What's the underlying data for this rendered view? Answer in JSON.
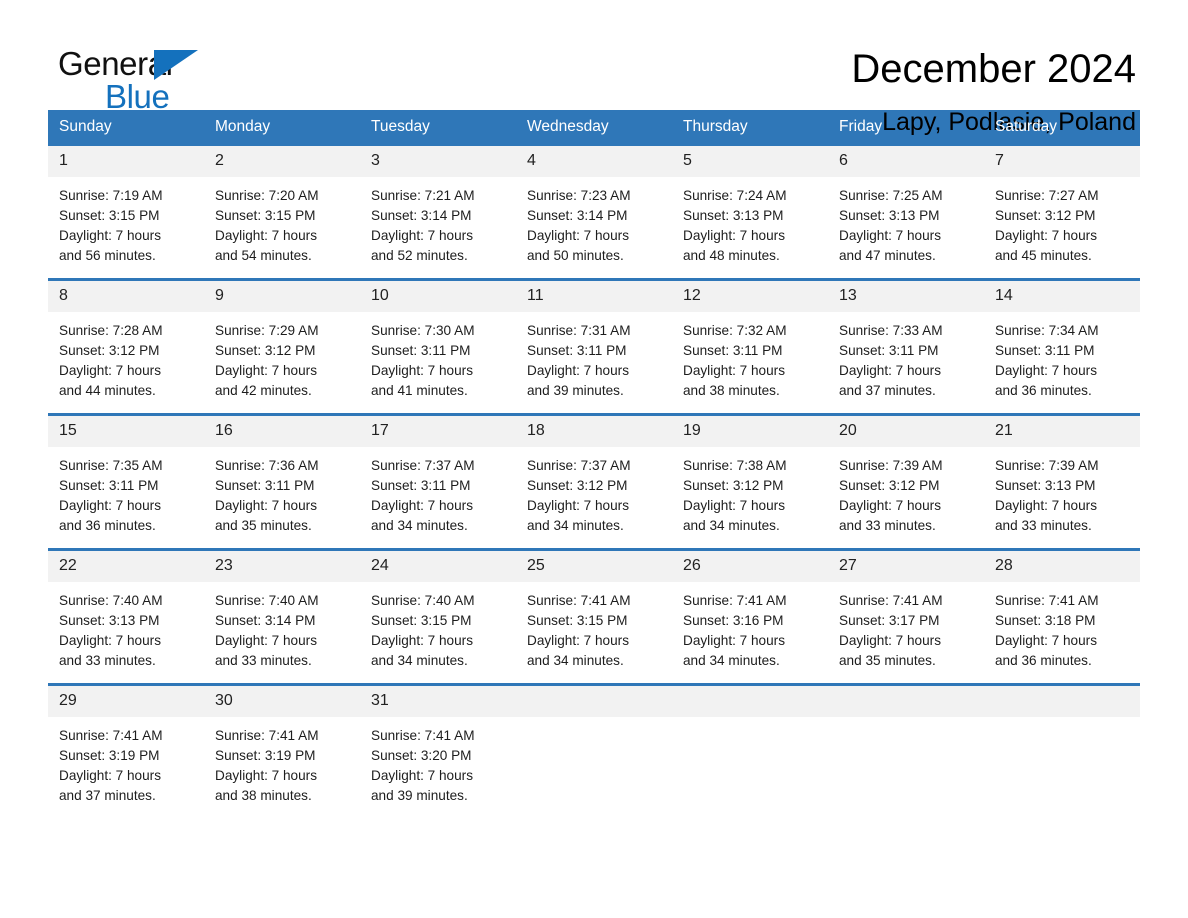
{
  "brand": {
    "name_part1": "General",
    "name_part2": "Blue",
    "accent_color": "#1471bd"
  },
  "header": {
    "title": "December 2024",
    "location": "Lapy, Podlasie, Poland"
  },
  "calendar": {
    "header_bg": "#2f77b8",
    "daynum_bg": "#f2f2f2",
    "weekday_headers": [
      "Sunday",
      "Monday",
      "Tuesday",
      "Wednesday",
      "Thursday",
      "Friday",
      "Saturday"
    ],
    "weeks": [
      [
        {
          "day": "1",
          "sunrise": "Sunrise: 7:19 AM",
          "sunset": "Sunset: 3:15 PM",
          "daylight_line1": "Daylight: 7 hours",
          "daylight_line2": "and 56 minutes."
        },
        {
          "day": "2",
          "sunrise": "Sunrise: 7:20 AM",
          "sunset": "Sunset: 3:15 PM",
          "daylight_line1": "Daylight: 7 hours",
          "daylight_line2": "and 54 minutes."
        },
        {
          "day": "3",
          "sunrise": "Sunrise: 7:21 AM",
          "sunset": "Sunset: 3:14 PM",
          "daylight_line1": "Daylight: 7 hours",
          "daylight_line2": "and 52 minutes."
        },
        {
          "day": "4",
          "sunrise": "Sunrise: 7:23 AM",
          "sunset": "Sunset: 3:14 PM",
          "daylight_line1": "Daylight: 7 hours",
          "daylight_line2": "and 50 minutes."
        },
        {
          "day": "5",
          "sunrise": "Sunrise: 7:24 AM",
          "sunset": "Sunset: 3:13 PM",
          "daylight_line1": "Daylight: 7 hours",
          "daylight_line2": "and 48 minutes."
        },
        {
          "day": "6",
          "sunrise": "Sunrise: 7:25 AM",
          "sunset": "Sunset: 3:13 PM",
          "daylight_line1": "Daylight: 7 hours",
          "daylight_line2": "and 47 minutes."
        },
        {
          "day": "7",
          "sunrise": "Sunrise: 7:27 AM",
          "sunset": "Sunset: 3:12 PM",
          "daylight_line1": "Daylight: 7 hours",
          "daylight_line2": "and 45 minutes."
        }
      ],
      [
        {
          "day": "8",
          "sunrise": "Sunrise: 7:28 AM",
          "sunset": "Sunset: 3:12 PM",
          "daylight_line1": "Daylight: 7 hours",
          "daylight_line2": "and 44 minutes."
        },
        {
          "day": "9",
          "sunrise": "Sunrise: 7:29 AM",
          "sunset": "Sunset: 3:12 PM",
          "daylight_line1": "Daylight: 7 hours",
          "daylight_line2": "and 42 minutes."
        },
        {
          "day": "10",
          "sunrise": "Sunrise: 7:30 AM",
          "sunset": "Sunset: 3:11 PM",
          "daylight_line1": "Daylight: 7 hours",
          "daylight_line2": "and 41 minutes."
        },
        {
          "day": "11",
          "sunrise": "Sunrise: 7:31 AM",
          "sunset": "Sunset: 3:11 PM",
          "daylight_line1": "Daylight: 7 hours",
          "daylight_line2": "and 39 minutes."
        },
        {
          "day": "12",
          "sunrise": "Sunrise: 7:32 AM",
          "sunset": "Sunset: 3:11 PM",
          "daylight_line1": "Daylight: 7 hours",
          "daylight_line2": "and 38 minutes."
        },
        {
          "day": "13",
          "sunrise": "Sunrise: 7:33 AM",
          "sunset": "Sunset: 3:11 PM",
          "daylight_line1": "Daylight: 7 hours",
          "daylight_line2": "and 37 minutes."
        },
        {
          "day": "14",
          "sunrise": "Sunrise: 7:34 AM",
          "sunset": "Sunset: 3:11 PM",
          "daylight_line1": "Daylight: 7 hours",
          "daylight_line2": "and 36 minutes."
        }
      ],
      [
        {
          "day": "15",
          "sunrise": "Sunrise: 7:35 AM",
          "sunset": "Sunset: 3:11 PM",
          "daylight_line1": "Daylight: 7 hours",
          "daylight_line2": "and 36 minutes."
        },
        {
          "day": "16",
          "sunrise": "Sunrise: 7:36 AM",
          "sunset": "Sunset: 3:11 PM",
          "daylight_line1": "Daylight: 7 hours",
          "daylight_line2": "and 35 minutes."
        },
        {
          "day": "17",
          "sunrise": "Sunrise: 7:37 AM",
          "sunset": "Sunset: 3:11 PM",
          "daylight_line1": "Daylight: 7 hours",
          "daylight_line2": "and 34 minutes."
        },
        {
          "day": "18",
          "sunrise": "Sunrise: 7:37 AM",
          "sunset": "Sunset: 3:12 PM",
          "daylight_line1": "Daylight: 7 hours",
          "daylight_line2": "and 34 minutes."
        },
        {
          "day": "19",
          "sunrise": "Sunrise: 7:38 AM",
          "sunset": "Sunset: 3:12 PM",
          "daylight_line1": "Daylight: 7 hours",
          "daylight_line2": "and 34 minutes."
        },
        {
          "day": "20",
          "sunrise": "Sunrise: 7:39 AM",
          "sunset": "Sunset: 3:12 PM",
          "daylight_line1": "Daylight: 7 hours",
          "daylight_line2": "and 33 minutes."
        },
        {
          "day": "21",
          "sunrise": "Sunrise: 7:39 AM",
          "sunset": "Sunset: 3:13 PM",
          "daylight_line1": "Daylight: 7 hours",
          "daylight_line2": "and 33 minutes."
        }
      ],
      [
        {
          "day": "22",
          "sunrise": "Sunrise: 7:40 AM",
          "sunset": "Sunset: 3:13 PM",
          "daylight_line1": "Daylight: 7 hours",
          "daylight_line2": "and 33 minutes."
        },
        {
          "day": "23",
          "sunrise": "Sunrise: 7:40 AM",
          "sunset": "Sunset: 3:14 PM",
          "daylight_line1": "Daylight: 7 hours",
          "daylight_line2": "and 33 minutes."
        },
        {
          "day": "24",
          "sunrise": "Sunrise: 7:40 AM",
          "sunset": "Sunset: 3:15 PM",
          "daylight_line1": "Daylight: 7 hours",
          "daylight_line2": "and 34 minutes."
        },
        {
          "day": "25",
          "sunrise": "Sunrise: 7:41 AM",
          "sunset": "Sunset: 3:15 PM",
          "daylight_line1": "Daylight: 7 hours",
          "daylight_line2": "and 34 minutes."
        },
        {
          "day": "26",
          "sunrise": "Sunrise: 7:41 AM",
          "sunset": "Sunset: 3:16 PM",
          "daylight_line1": "Daylight: 7 hours",
          "daylight_line2": "and 34 minutes."
        },
        {
          "day": "27",
          "sunrise": "Sunrise: 7:41 AM",
          "sunset": "Sunset: 3:17 PM",
          "daylight_line1": "Daylight: 7 hours",
          "daylight_line2": "and 35 minutes."
        },
        {
          "day": "28",
          "sunrise": "Sunrise: 7:41 AM",
          "sunset": "Sunset: 3:18 PM",
          "daylight_line1": "Daylight: 7 hours",
          "daylight_line2": "and 36 minutes."
        }
      ],
      [
        {
          "day": "29",
          "sunrise": "Sunrise: 7:41 AM",
          "sunset": "Sunset: 3:19 PM",
          "daylight_line1": "Daylight: 7 hours",
          "daylight_line2": "and 37 minutes."
        },
        {
          "day": "30",
          "sunrise": "Sunrise: 7:41 AM",
          "sunset": "Sunset: 3:19 PM",
          "daylight_line1": "Daylight: 7 hours",
          "daylight_line2": "and 38 minutes."
        },
        {
          "day": "31",
          "sunrise": "Sunrise: 7:41 AM",
          "sunset": "Sunset: 3:20 PM",
          "daylight_line1": "Daylight: 7 hours",
          "daylight_line2": "and 39 minutes."
        },
        {
          "day": "",
          "sunrise": "",
          "sunset": "",
          "daylight_line1": "",
          "daylight_line2": ""
        },
        {
          "day": "",
          "sunrise": "",
          "sunset": "",
          "daylight_line1": "",
          "daylight_line2": ""
        },
        {
          "day": "",
          "sunrise": "",
          "sunset": "",
          "daylight_line1": "",
          "daylight_line2": ""
        },
        {
          "day": "",
          "sunrise": "",
          "sunset": "",
          "daylight_line1": "",
          "daylight_line2": ""
        }
      ]
    ]
  }
}
